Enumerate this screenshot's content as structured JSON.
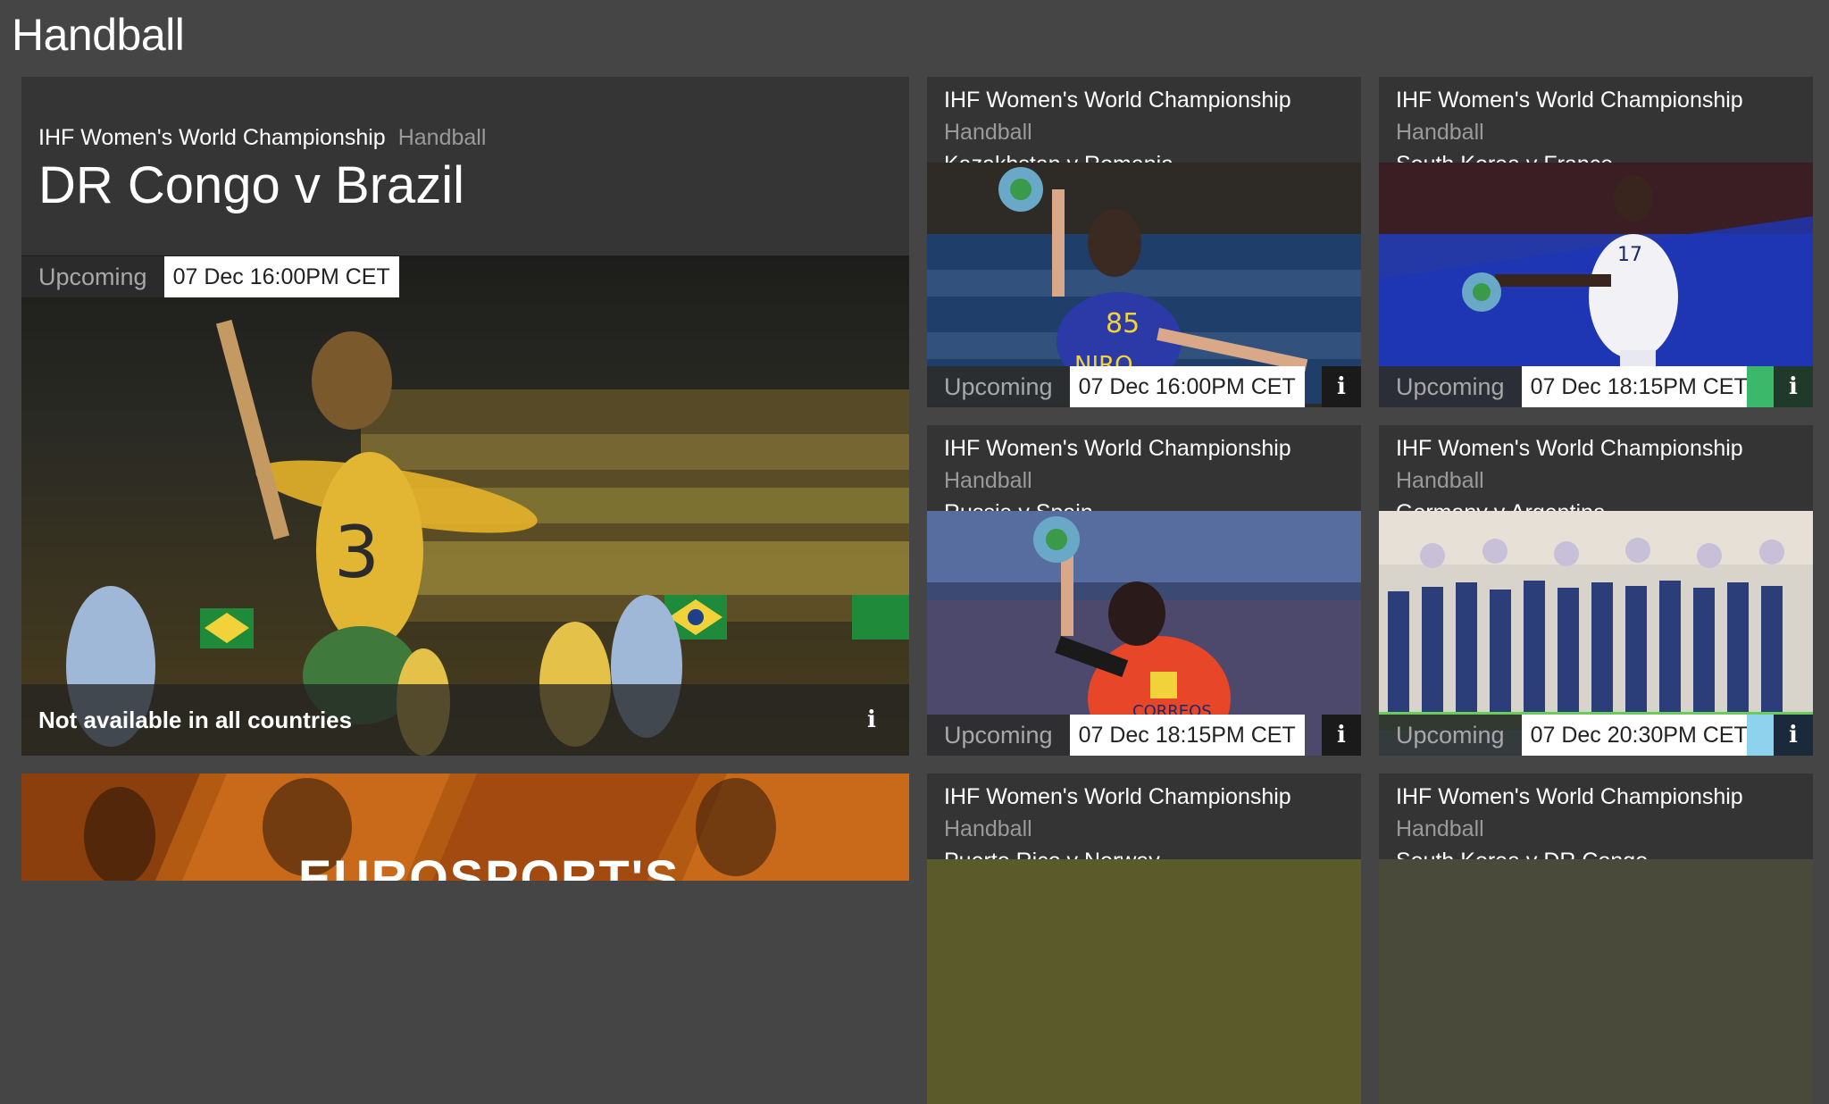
{
  "page": {
    "title": "Handball"
  },
  "featured": {
    "league": "IHF Women's World Championship",
    "sport": "Handball",
    "match": "DR Congo v Brazil",
    "status": "Upcoming",
    "time": "07 Dec 16:00PM CET",
    "availability": "Not available in all countries",
    "info_icon": "i"
  },
  "cards": [
    {
      "league": "IHF Women's World Championship",
      "sport": "Handball",
      "teams": "Kazakhstan v Romania",
      "status": "Upcoming",
      "time": "07 Dec 16:00PM CET",
      "info_icon": "i"
    },
    {
      "league": "IHF Women's World Championship",
      "sport": "Handball",
      "teams": "South Korea v France",
      "status": "Upcoming",
      "time": "07 Dec 18:15PM CET",
      "info_icon": "i"
    },
    {
      "league": "IHF Women's World Championship",
      "sport": "Handball",
      "teams": "Russia v Spain",
      "status": "Upcoming",
      "time": "07 Dec 18:15PM CET",
      "info_icon": "i"
    },
    {
      "league": "IHF Women's World Championship",
      "sport": "Handball",
      "teams": "Germany v Argentina",
      "status": "Upcoming",
      "time": "07 Dec 20:30PM CET",
      "info_icon": "i"
    },
    {
      "league": "IHF Women's World Championship",
      "sport": "Handball",
      "teams": "Puerto Rico v Norway"
    },
    {
      "league": "IHF Women's World Championship",
      "sport": "Handball",
      "teams": "South Korea v DR Congo"
    }
  ],
  "promo": {
    "text": "EUROSPORT'S"
  }
}
